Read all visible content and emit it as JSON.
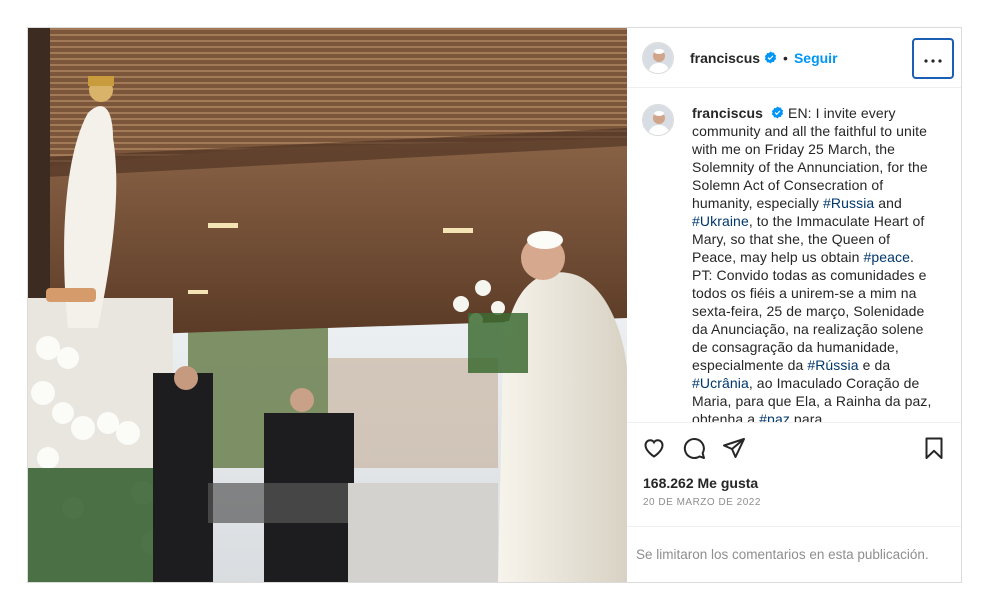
{
  "post": {
    "username": "franciscus",
    "follow_label": "Seguir",
    "separator": "•",
    "more_icon": "more-horizontal-icon",
    "verified_icon": "verified-badge-icon"
  },
  "caption": {
    "username": "franciscus",
    "segments": [
      {
        "text": " EN: I invite every community and all the faithful to unite with me on Friday 25 March, the Solemnity of the Annunciation, for the Solemn Act of Consecration of humanity, especially ",
        "link": false
      },
      {
        "text": "#Russia",
        "link": true
      },
      {
        "text": " and ",
        "link": false
      },
      {
        "text": "#Ukraine",
        "link": true
      },
      {
        "text": ", to the Immaculate Heart of Mary, so that she, the Queen of Peace, may help us obtain ",
        "link": false
      },
      {
        "text": "#peace",
        "link": true
      },
      {
        "text": ". PT: Convido todas as comunidades e todos os fiéis a unirem-se a mim na sexta-feira, 25 de março, Solenidade da Anunciação, na realização solene de consagração da humanidade, especialmente da ",
        "link": false
      },
      {
        "text": "#Rússia",
        "link": true
      },
      {
        "text": " e da ",
        "link": false
      },
      {
        "text": "#Ucrânia",
        "link": true
      },
      {
        "text": ", ao Imaculado Coração de Maria, para que Ela, a Rainha da paz, obtenha a ",
        "link": false
      },
      {
        "text": "#paz",
        "link": true
      },
      {
        "text": " para",
        "link": false
      }
    ]
  },
  "actions": {
    "like_icon": "heart-icon",
    "comment_icon": "comment-icon",
    "share_icon": "share-icon",
    "save_icon": "bookmark-icon"
  },
  "stats": {
    "likes": "168.262 Me gusta",
    "date": "20 de marzo de 2022"
  },
  "comments_notice": "Se limitaron los comentarios en esta publicación.",
  "colors": {
    "link": "#00376b",
    "follow": "#0095f6",
    "verified": "#0095f6",
    "muted": "#8e8e8e",
    "border": "#dbdbdb"
  }
}
